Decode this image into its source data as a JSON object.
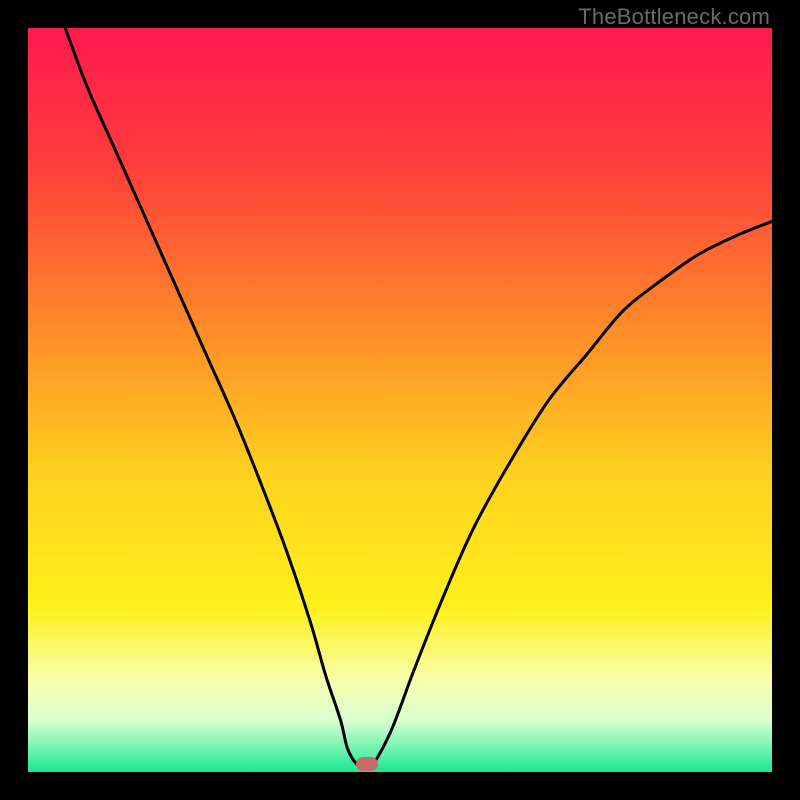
{
  "watermark": "TheBottleneck.com",
  "colors": {
    "frame": "#000000",
    "gradient_stops": [
      {
        "offset": 0.0,
        "color": "#ff1a4d"
      },
      {
        "offset": 0.18,
        "color": "#ff3c3c"
      },
      {
        "offset": 0.4,
        "color": "#ff8a2a"
      },
      {
        "offset": 0.6,
        "color": "#ffd21f"
      },
      {
        "offset": 0.78,
        "color": "#fff11c"
      },
      {
        "offset": 0.88,
        "color": "#f8ffb0"
      },
      {
        "offset": 0.93,
        "color": "#d9ffcf"
      },
      {
        "offset": 0.965,
        "color": "#7cf5b5"
      },
      {
        "offset": 1.0,
        "color": "#19e892"
      }
    ],
    "curve": "#000000",
    "marker": "#c66a6a"
  },
  "chart_data": {
    "type": "line",
    "title": "",
    "xlabel": "",
    "ylabel": "",
    "xlim": [
      0,
      100
    ],
    "ylim": [
      0,
      100
    ],
    "grid": false,
    "legend": false,
    "note": "Values are estimated by reading pixel positions off the figure; axes have no visible numeric ticks so x and y are normalized 0–100 (left→right, bottom→top).",
    "series": [
      {
        "name": "bottleneck-curve",
        "x": [
          5,
          8,
          12,
          16,
          20,
          24,
          28,
          32,
          35,
          38,
          40,
          42,
          43,
          44.5,
          46,
          47,
          49,
          52,
          56,
          60,
          65,
          70,
          75,
          80,
          85,
          90,
          95,
          100
        ],
        "y": [
          100,
          92,
          83,
          74,
          65,
          56,
          47,
          37,
          29,
          20,
          13,
          7,
          3,
          0.8,
          0.8,
          2,
          6,
          14,
          24,
          33,
          42,
          50,
          56,
          62,
          66,
          69.5,
          72,
          74
        ]
      }
    ],
    "marker": {
      "x": 45.5,
      "y": 1.1,
      "shape": "pill"
    }
  }
}
